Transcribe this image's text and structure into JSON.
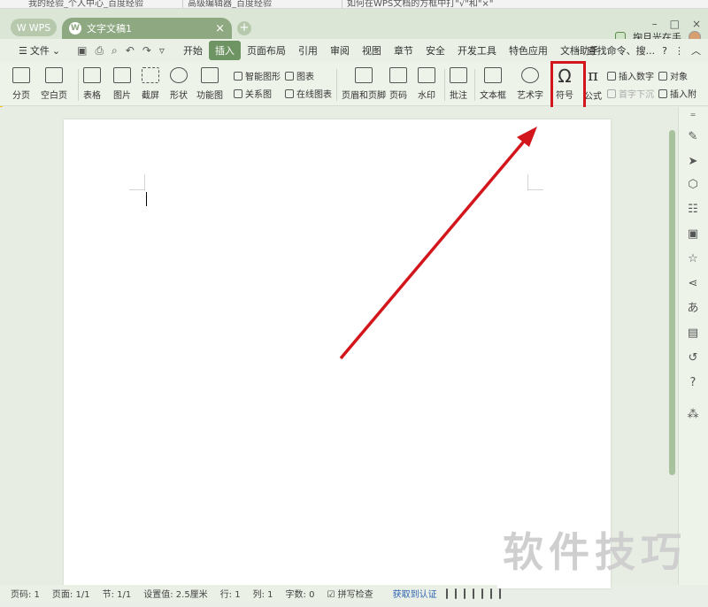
{
  "browser_tabs": [
    {
      "label": "我的经验_个人中心_百度经验"
    },
    {
      "label": "高级编辑器_百度经验"
    },
    {
      "label": "如何在WPS文档的方框中打\"√\"和\"×\""
    }
  ],
  "tabbar": {
    "wps_label": "WPS",
    "doc_title": "文字文稿1",
    "username": "掬月光在手"
  },
  "menu": {
    "file": "文件",
    "items": [
      "开始",
      "插入",
      "页面布局",
      "引用",
      "审阅",
      "视图",
      "章节",
      "安全",
      "开发工具",
      "特色应用",
      "文档助手"
    ],
    "active": "插入",
    "search": "查找命令、搜..."
  },
  "ribbon": {
    "page_break": "分页",
    "blank_page": "空白页",
    "table": "表格",
    "picture": "图片",
    "screenshot": "截屏",
    "shapes": "形状",
    "function_chart": "功能图",
    "smart_art": "智能图形",
    "chart": "图表",
    "relation_chart": "关系图",
    "online_chart": "在线图表",
    "header_footer": "页眉和页脚",
    "page_number": "页码",
    "watermark": "水印",
    "comment": "批注",
    "text_box": "文本框",
    "word_art": "艺术字",
    "symbol": "符号",
    "formula": "公式",
    "insert_number": "插入数字",
    "object": "对象",
    "drop_cap": "首字下沉",
    "insert_attach": "插入附"
  },
  "statusbar": {
    "page_no": "页码: 1",
    "pages": "页面: 1/1",
    "section": "节: 1/1",
    "setting": "设置值: 2.5厘米",
    "row": "行: 1",
    "col": "列: 1",
    "word_count": "字数: 0",
    "spell_check": "拼写检查",
    "certify": "获取到认证"
  },
  "watermark_text": "软件技巧",
  "colors": {
    "accent": "#6f9463",
    "highlight_box": "#d2161b",
    "arrow": "#d2161b"
  }
}
